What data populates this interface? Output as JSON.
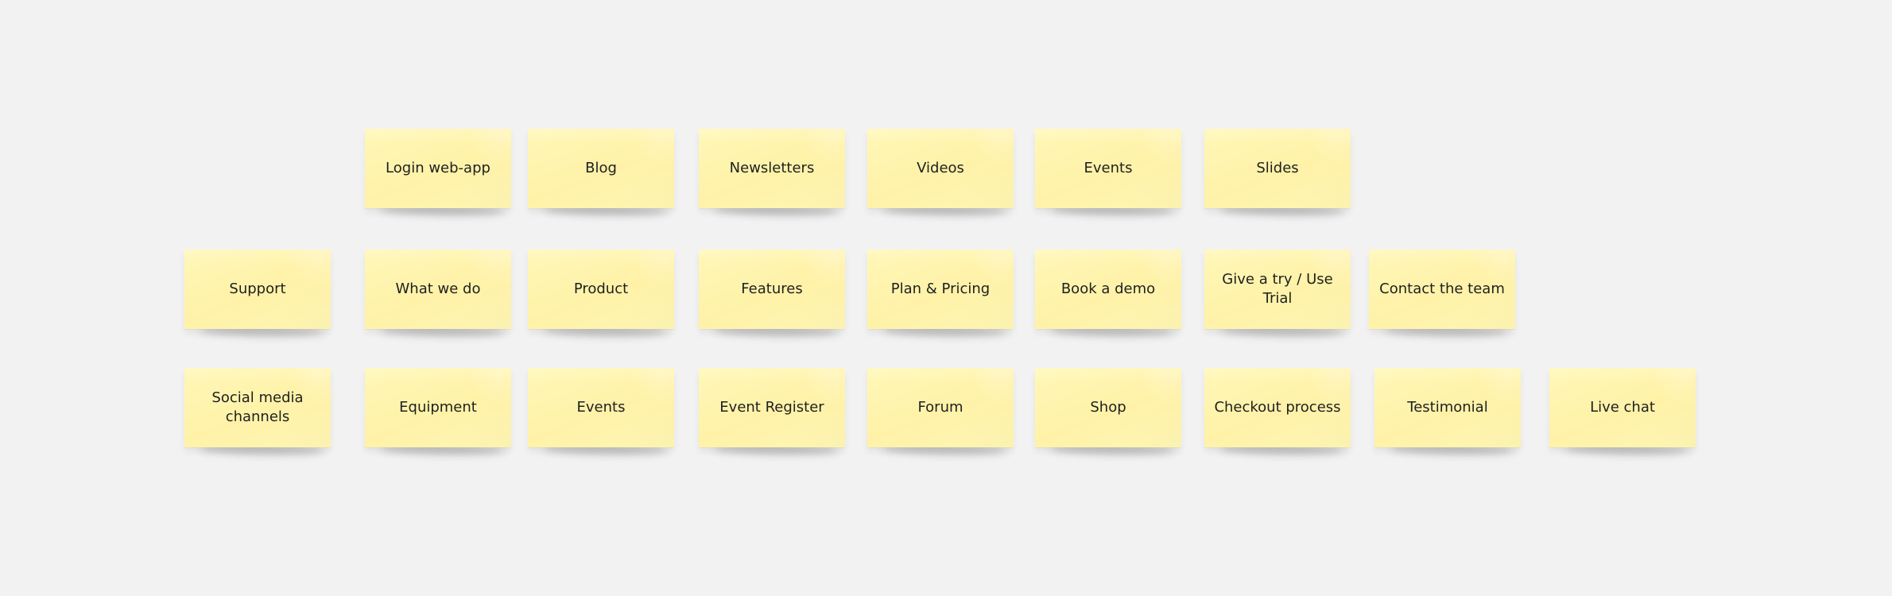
{
  "board": {
    "rows": [
      {
        "notes": [
          {
            "text": "Login web-app"
          },
          {
            "text": "Blog"
          },
          {
            "text": "Newsletters"
          },
          {
            "text": "Videos"
          },
          {
            "text": "Events"
          },
          {
            "text": "Slides"
          }
        ]
      },
      {
        "notes": [
          {
            "text": "Support"
          },
          {
            "text": "What we do"
          },
          {
            "text": "Product"
          },
          {
            "text": "Features"
          },
          {
            "text": "Plan & Pricing"
          },
          {
            "text": "Book a demo"
          },
          {
            "text": "Give a try / Use Trial"
          },
          {
            "text": "Contact the team"
          }
        ]
      },
      {
        "notes": [
          {
            "text": "Social media channels"
          },
          {
            "text": "Equipment"
          },
          {
            "text": "Events"
          },
          {
            "text": "Event Register"
          },
          {
            "text": "Forum"
          },
          {
            "text": "Shop"
          },
          {
            "text": "Checkout process"
          },
          {
            "text": "Testimonial"
          },
          {
            "text": "Live chat"
          }
        ]
      }
    ]
  },
  "colors": {
    "background": "#f2f2f2",
    "sticky_note": "#fff3ad",
    "text": "#1f1f1f"
  }
}
